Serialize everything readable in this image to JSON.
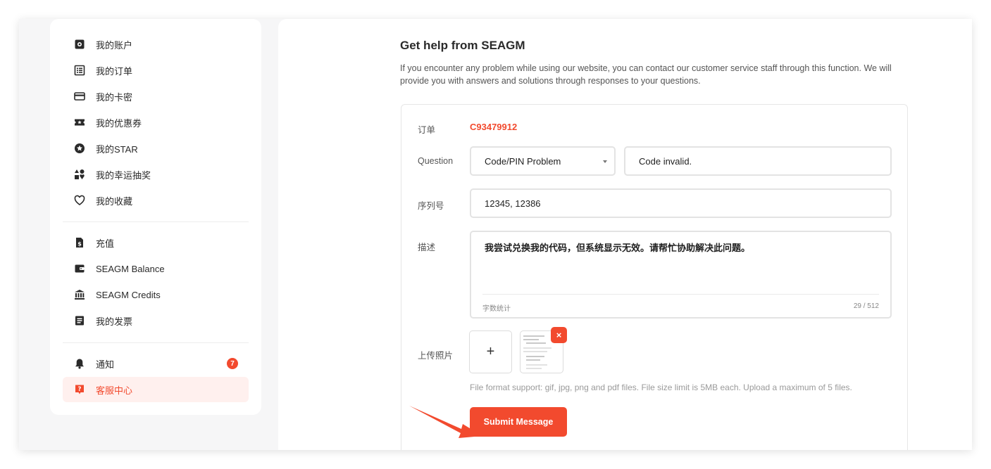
{
  "sidebar": {
    "group1": [
      {
        "label": "我的账户",
        "icon": "account-icon"
      },
      {
        "label": "我的订单",
        "icon": "orders-icon"
      },
      {
        "label": "我的卡密",
        "icon": "card-icon"
      },
      {
        "label": "我的优惠券",
        "icon": "ticket-icon"
      },
      {
        "label": "我的STAR",
        "icon": "star-icon"
      },
      {
        "label": "我的幸运抽奖",
        "icon": "shapes-icon"
      },
      {
        "label": "我的收藏",
        "icon": "heart-icon"
      }
    ],
    "group2": [
      {
        "label": "充值",
        "icon": "document-dollar-icon"
      },
      {
        "label": "SEAGM Balance",
        "icon": "wallet-icon"
      },
      {
        "label": "SEAGM Credits",
        "icon": "bank-icon"
      },
      {
        "label": "我的发票",
        "icon": "invoice-icon"
      }
    ],
    "group3": [
      {
        "label": "通知",
        "icon": "bell-icon",
        "badge": "7"
      },
      {
        "label": "客服中心",
        "icon": "help-icon",
        "active": true
      }
    ]
  },
  "main": {
    "title": "Get help from SEAGM",
    "intro": "If you encounter any problem while using our website, you can contact our customer service staff through this function. We will provide you with answers and solutions through responses to your questions.",
    "form": {
      "order_label": "订单",
      "order_value": "C93479912",
      "question_label": "Question",
      "question_select": "Code/PIN Problem",
      "question_detail": "Code invalid.",
      "serial_label": "序列号",
      "serial_value": "12345, 12386",
      "desc_label": "描述",
      "desc_value": "我尝试兑换我的代码，但系统显示无效。请帮忙协助解决此问题。",
      "desc_counter_label": "字数统计",
      "desc_counter": "29 / 512",
      "upload_label": "上传照片",
      "upload_plus": "+",
      "remove_symbol": "×",
      "file_note": "File format support: gif, jpg, png and pdf files. File size limit is 5MB each. Upload a maximum of 5 files.",
      "submit_label": "Submit Message"
    }
  },
  "colors": {
    "accent": "#f24a2e",
    "active_bg": "#fff0ee",
    "page_bg": "#f6f6f7"
  }
}
